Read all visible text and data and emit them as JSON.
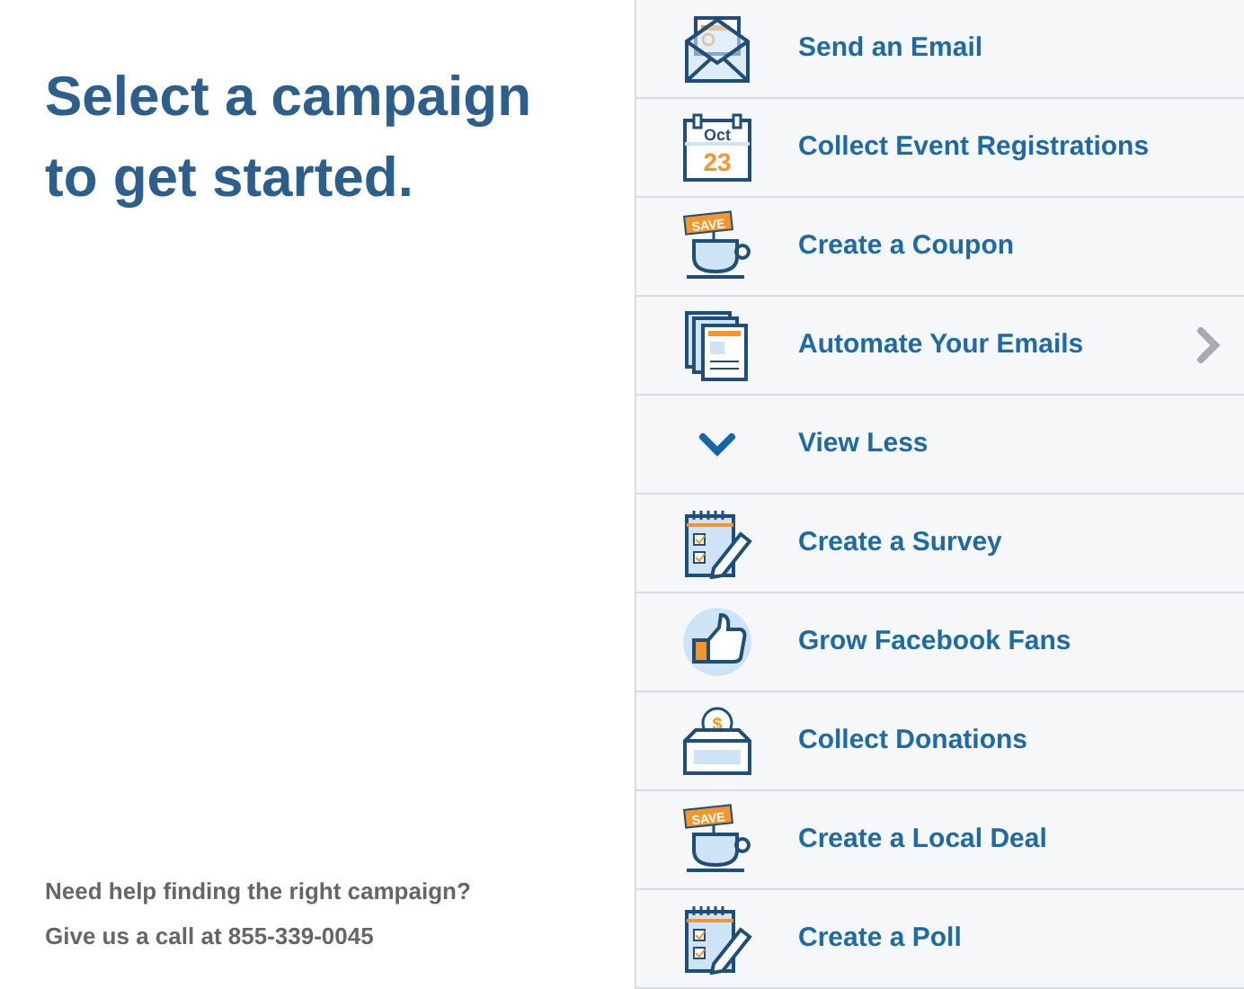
{
  "heading": "Select a campaign to get started.",
  "help": {
    "line_1": "Need help finding the right campaign?",
    "line_2": "Give us a call at 855-339-0045"
  },
  "campaigns": [
    {
      "kind": "campaign",
      "label": "Send an Email",
      "arrow": false
    },
    {
      "kind": "campaign",
      "icon_text": [
        "Oct",
        "23"
      ],
      "label": "Collect Event Registrations",
      "arrow": false
    },
    {
      "kind": "campaign",
      "icon_text": [
        "SAVE"
      ],
      "label": "Create a Coupon",
      "arrow": false
    },
    {
      "kind": "campaign",
      "label": "Automate Your Emails",
      "arrow": true
    },
    {
      "kind": "toggle",
      "label": "View Less",
      "expanded": true
    },
    {
      "kind": "campaign",
      "label": "Create a Survey",
      "arrow": false
    },
    {
      "kind": "campaign",
      "label": "Grow Facebook Fans",
      "arrow": false
    },
    {
      "kind": "campaign",
      "icon_text": [
        "$"
      ],
      "label": "Collect Donations",
      "arrow": false
    },
    {
      "kind": "campaign",
      "icon_text": [
        "SAVE"
      ],
      "label": "Create a Local Deal",
      "arrow": false
    },
    {
      "kind": "campaign",
      "label": "Create a Poll",
      "arrow": false
    }
  ]
}
